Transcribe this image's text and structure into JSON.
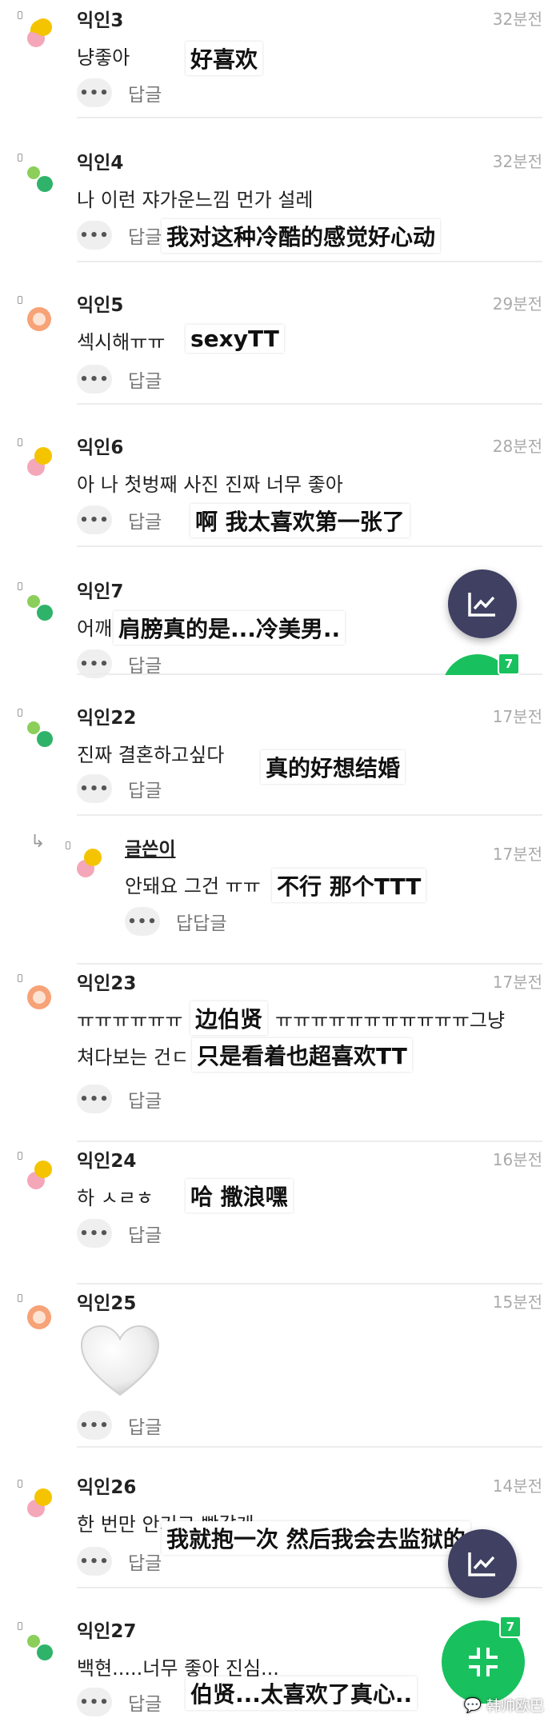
{
  "reply_label": "답글",
  "reply_reply_label": "답답글",
  "more_label": "•••",
  "comments": [
    {
      "name": "익인3",
      "time": "32분전",
      "text": "냥좋아",
      "caption": "好喜欢"
    },
    {
      "name": "익인4",
      "time": "32분전",
      "text": "나 이런 쟈가운느낌 먼가 설레",
      "caption": "我对这种冷酷的感觉好心动"
    },
    {
      "name": "익인5",
      "time": "29분전",
      "text": "섹시해ㅠㅠ",
      "caption": "sexyTT"
    },
    {
      "name": "익인6",
      "time": "28분전",
      "text": "아 나 첫벙째 사진 진짜 너무 좋아",
      "caption": "啊 我太喜欢第一张了"
    },
    {
      "name": "익인7",
      "time": "",
      "text": "어깨",
      "caption": "肩膀真的是...冷美男.."
    },
    {
      "name": "익인22",
      "time": "17분전",
      "text": "진짜 결혼하고싶다",
      "caption": "真的好想结婚"
    },
    {
      "name": "글쓴이",
      "time": "17분전",
      "text": "안돼요 그건 ㅠㅠ",
      "caption": "不行 那个TTT"
    },
    {
      "name": "익인23",
      "time": "17분전",
      "text": "ㅠㅠㅠㅠㅠㅠ",
      "text_tail": "ㅠㅠㅠㅠㅠㅠㅠㅠㅠㅠㅠ그냥",
      "text2": "쳐다보는 건ㄷ",
      "caption": "边伯贤",
      "caption2": "只是看着也超喜欢TT"
    },
    {
      "name": "익인24",
      "time": "16분전",
      "text": "하 ㅅㄹㅎ",
      "caption": "哈 撒浪嘿"
    },
    {
      "name": "익인25",
      "time": "15분전",
      "sticker": "heart"
    },
    {
      "name": "익인26",
      "time": "14분전",
      "text": "한 번만 안기고 빵갈게",
      "caption": "我就抱一次 然后我会去监狱的"
    },
    {
      "name": "익인27",
      "time": "",
      "text": "백현.....너무 좋아 진심...",
      "caption": "伯贤...太喜欢了真心.."
    }
  ],
  "fab_badge": "7",
  "watermark": "韩帅欧巴",
  "colors": {
    "fab_chart": "#3f4062",
    "fab_green": "#19c15e"
  }
}
